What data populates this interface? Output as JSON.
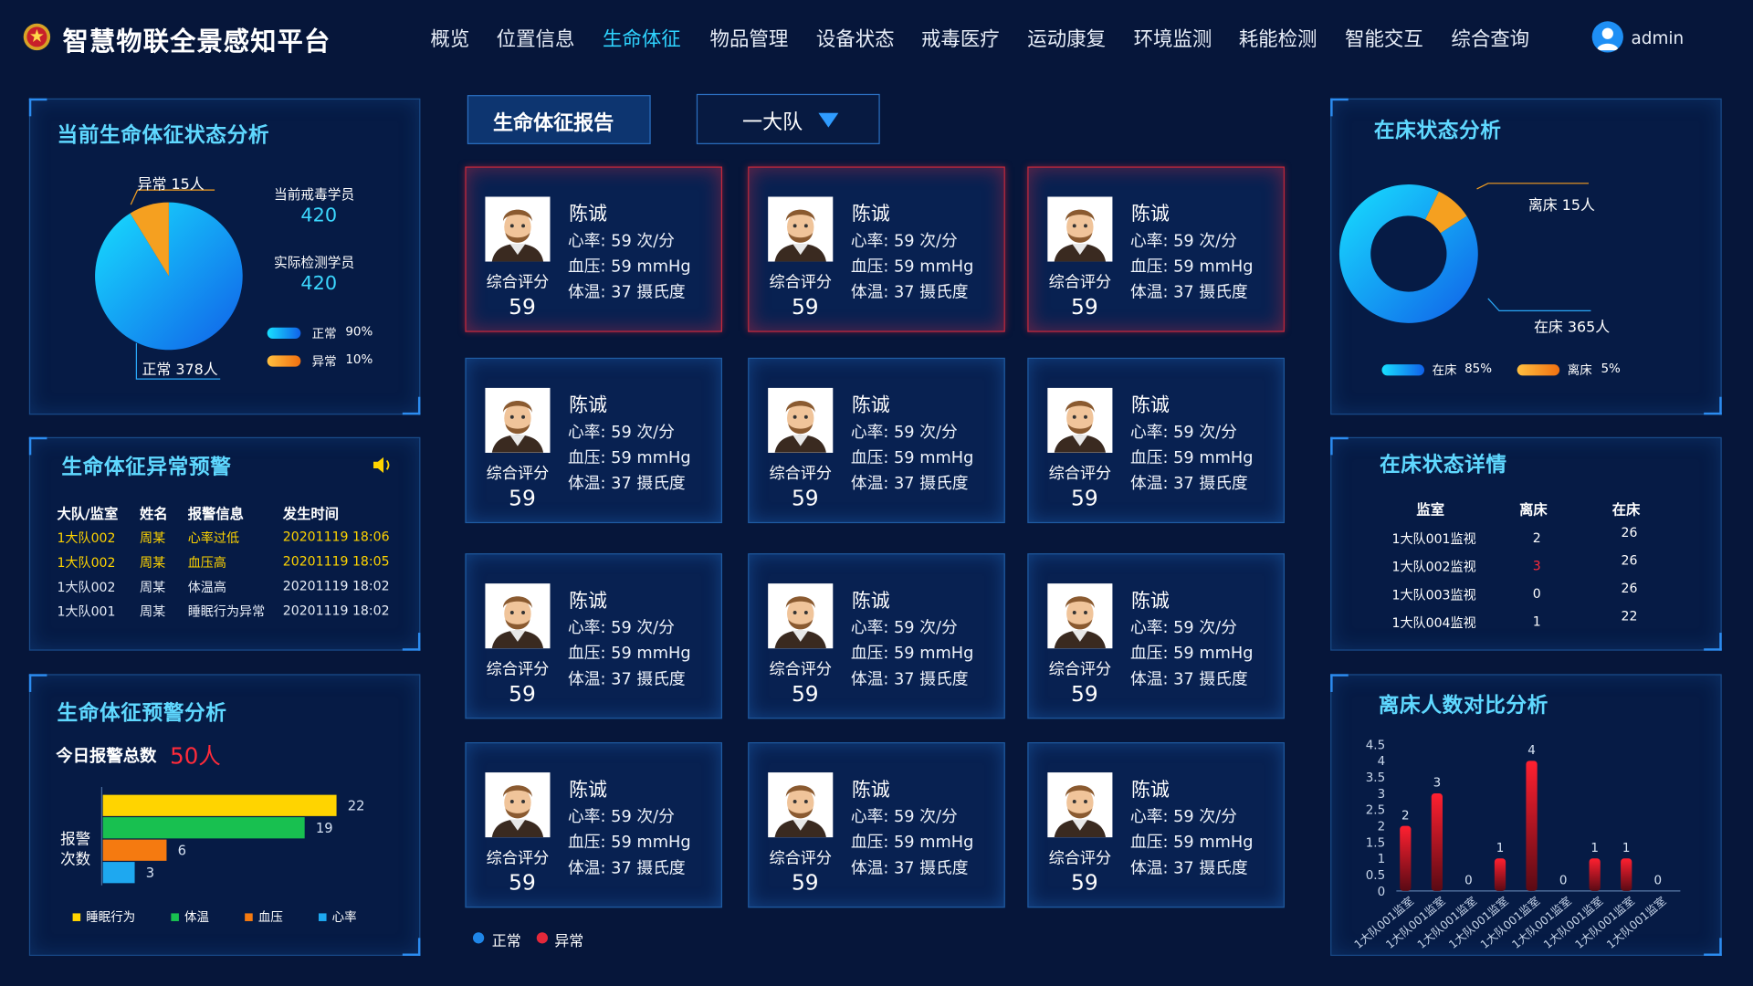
{
  "header": {
    "title": "智慧物联全景感知平台",
    "nav": [
      "概览",
      "位置信息",
      "生命体征",
      "物品管理",
      "设备状态",
      "戒毒医疗",
      "运动康复",
      "环境监测",
      "耗能检测",
      "智能交互",
      "综合查询"
    ],
    "active_index": 2,
    "user": "admin"
  },
  "status_panel": {
    "title": "当前生命体征状态分析",
    "abnormal_label": "异常 15人",
    "normal_label": "正常 378人",
    "current_label": "当前戒毒学员",
    "current_value": "420",
    "actual_label": "实际检测学员",
    "actual_value": "420",
    "legend": [
      {
        "label": "正常",
        "pct": "90%",
        "color": "#2aa8f8"
      },
      {
        "label": "异常",
        "pct": "10%",
        "color": "#f5a020"
      }
    ],
    "pie": [
      {
        "name": "正常",
        "value": 378
      },
      {
        "name": "异常",
        "value": 15
      }
    ]
  },
  "warning_panel": {
    "title": "生命体征异常预警",
    "headers": [
      "大队/监室",
      "姓名",
      "报警信息",
      "发生时间"
    ],
    "rows": [
      [
        "1大队002",
        "周某",
        "心率过低",
        "20201119 18:06"
      ],
      [
        "1大队002",
        "周某",
        "血压高",
        "20201119 18:05"
      ],
      [
        "1大队002",
        "周某",
        "体温高",
        "20201119 18:02"
      ],
      [
        "1大队001",
        "周某",
        "睡眠行为异常",
        "20201119 18:02"
      ]
    ],
    "highlight_rows": 2
  },
  "alarm_panel": {
    "title": "生命体征预警分析",
    "total_label": "今日报警总数",
    "total_value": "50人",
    "axis_label_1": "报警",
    "axis_label_2": "次数",
    "legend": [
      "睡眠行为",
      "体温",
      "血压",
      "心率"
    ]
  },
  "center": {
    "report_tab": "生命体征报告",
    "dropdown": "一大队",
    "legend_normal": "正常",
    "legend_abnormal": "异常"
  },
  "card_template": {
    "name": "陈诚",
    "hr": "心率: 59 次/分",
    "bp": "血压: 59 mmHg",
    "temp": "体温: 37 摄氏度",
    "score_label": "综合评分",
    "score": "59"
  },
  "cards_alert": [
    true,
    true,
    true,
    false,
    false,
    false,
    false,
    false,
    false,
    false,
    false,
    false
  ],
  "bed_panel": {
    "title": "在床状态分析",
    "off_label": "离床 15人",
    "on_label": "在床 365人",
    "legend": [
      {
        "label": "在床",
        "pct": "85%"
      },
      {
        "label": "离床",
        "pct": "5%"
      }
    ],
    "donut": [
      {
        "name": "在床",
        "value": 365
      },
      {
        "name": "离床",
        "value": 15
      }
    ]
  },
  "bed_detail": {
    "title": "在床状态详情",
    "headers": [
      "监室",
      "离床",
      "在床"
    ],
    "rows": [
      [
        "1大队001监视",
        "2",
        "26"
      ],
      [
        "1大队002监视",
        "3",
        "26"
      ],
      [
        "1大队003监视",
        "0",
        "26"
      ],
      [
        "1大队004监视",
        "1",
        "22"
      ]
    ],
    "red_cell": {
      "row": 1,
      "col": 1
    }
  },
  "leave_panel": {
    "title": "离床人数对比分析"
  },
  "chart_data": [
    {
      "type": "bar",
      "orientation": "horizontal",
      "categories": [
        "睡眠行为",
        "体温",
        "血压",
        "心率"
      ],
      "values": [
        22,
        19,
        6,
        3
      ],
      "ylabel": "报警次数",
      "colors": [
        "#ffd400",
        "#18c050",
        "#f57a10",
        "#1ea8f0"
      ]
    },
    {
      "type": "bar",
      "categories": [
        "1大队001监室",
        "1大队001监室",
        "1大队001监室",
        "1大队001监室",
        "1大队001监室",
        "1大队001监室",
        "1大队001监室",
        "1大队001监室",
        "1大队001监室"
      ],
      "values": [
        2,
        3,
        0,
        1,
        4,
        0,
        1,
        1,
        0
      ],
      "ylim": [
        0,
        4.5
      ],
      "yticks": [
        "0",
        "0.5",
        "1",
        "1.5",
        "2",
        "2.5",
        "3",
        "3.5",
        "4",
        "4.5"
      ]
    }
  ]
}
